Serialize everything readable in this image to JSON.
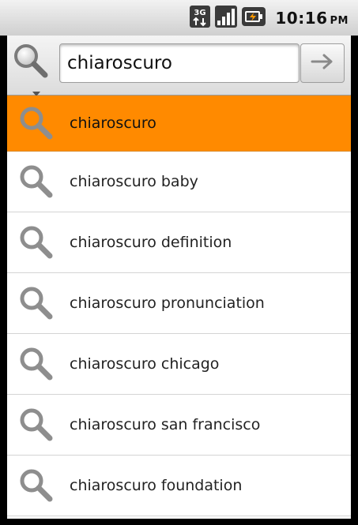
{
  "status_bar": {
    "network_badge": "3G",
    "time": "10:16",
    "ampm": "PM",
    "icons": [
      "network-3g-icon",
      "signal-strength-icon",
      "battery-charging-icon"
    ]
  },
  "search": {
    "source_icon": "search-icon",
    "query": "chiaroscuro",
    "go_icon": "arrow-right-icon"
  },
  "suggestions": [
    {
      "text": "chiaroscuro",
      "selected": true
    },
    {
      "text": "chiaroscuro baby",
      "selected": false
    },
    {
      "text": "chiaroscuro definition",
      "selected": false
    },
    {
      "text": "chiaroscuro pronunciation",
      "selected": false
    },
    {
      "text": "chiaroscuro chicago",
      "selected": false
    },
    {
      "text": "chiaroscuro san francisco",
      "selected": false
    },
    {
      "text": "chiaroscuro foundation",
      "selected": false
    }
  ],
  "colors": {
    "selection": "#ff8a00",
    "list_background": "#ffffff",
    "frame": "#000000"
  }
}
